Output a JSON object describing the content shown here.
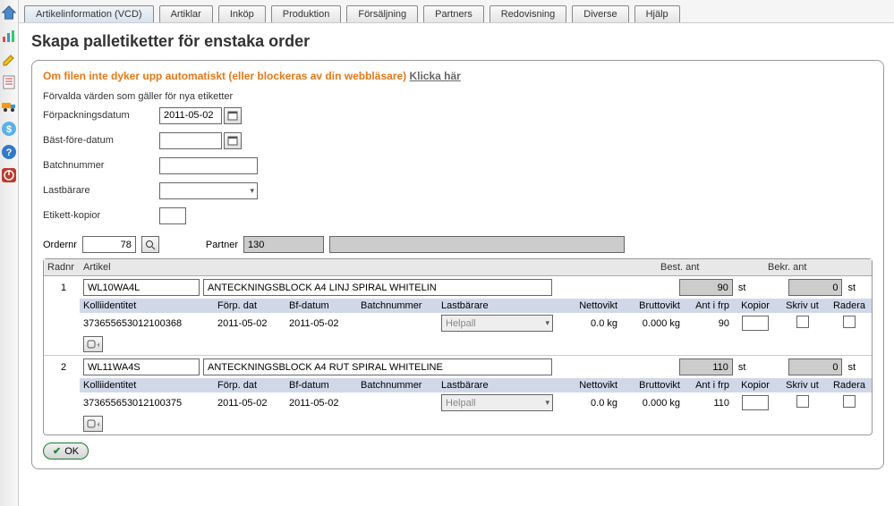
{
  "tabs": [
    "Artikelinformation (VCD)",
    "Artiklar",
    "Inköp",
    "Produktion",
    "Försäljning",
    "Partners",
    "Redovisning",
    "Diverse",
    "Hjälp"
  ],
  "page_title": "Skapa palletiketter för enstaka order",
  "warn_text": "Om filen inte dyker upp automatiskt (eller blockeras av din webbläsare) ",
  "warn_link": "Klicka här",
  "defaults_title": "Förvalda värden som gäller för nya etiketter",
  "labels": {
    "forpack": "Förpackningsdatum",
    "bast": "Bäst-före-datum",
    "batch": "Batchnummer",
    "last": "Lastbärare",
    "kopior": "Etikett-kopior",
    "ordernr": "Ordernr",
    "partner": "Partner"
  },
  "defaults": {
    "forpack_date": "2011-05-02",
    "bast_date": "",
    "batch": "",
    "last": "",
    "kopior": ""
  },
  "order": {
    "nr": "78",
    "partner": "130"
  },
  "grid_headers": {
    "radnr": "Radnr",
    "artikel": "Artikel",
    "best": "Best. ant",
    "bekr": "Bekr. ant"
  },
  "sub_headers": {
    "kolli": "Kolliidentitet",
    "forp": "Förp. dat",
    "bf": "Bf-datum",
    "batch": "Batchnummer",
    "last": "Lastbärare",
    "netto": "Nettovikt",
    "brutto": "Bruttovikt",
    "ant": "Ant i frp",
    "kopior": "Kopior",
    "skriv": "Skriv ut",
    "radera": "Radera"
  },
  "unit": "st",
  "rows": [
    {
      "num": "1",
      "code": "WL10WA4L",
      "desc": "ANTECKNINGSBLOCK A4 LINJ SPIRAL WHITELIN",
      "best": "90",
      "bekr": "0",
      "sub": {
        "kolli": "373655653012100368",
        "forp": "2011-05-02",
        "bf": "2011-05-02",
        "batch": "",
        "last": "Helpall",
        "netto": "0.0 kg",
        "brutto": "0.000 kg",
        "ant": "90",
        "kopior": ""
      }
    },
    {
      "num": "2",
      "code": "WL11WA4S",
      "desc": "ANTECKNINGSBLOCK A4 RUT SPIRAL WHITELINE",
      "best": "110",
      "bekr": "0",
      "sub": {
        "kolli": "373655653012100375",
        "forp": "2011-05-02",
        "bf": "2011-05-02",
        "batch": "",
        "last": "Helpall",
        "netto": "0.0 kg",
        "brutto": "0.000 kg",
        "ant": "110",
        "kopior": ""
      }
    }
  ],
  "ok_label": "OK"
}
